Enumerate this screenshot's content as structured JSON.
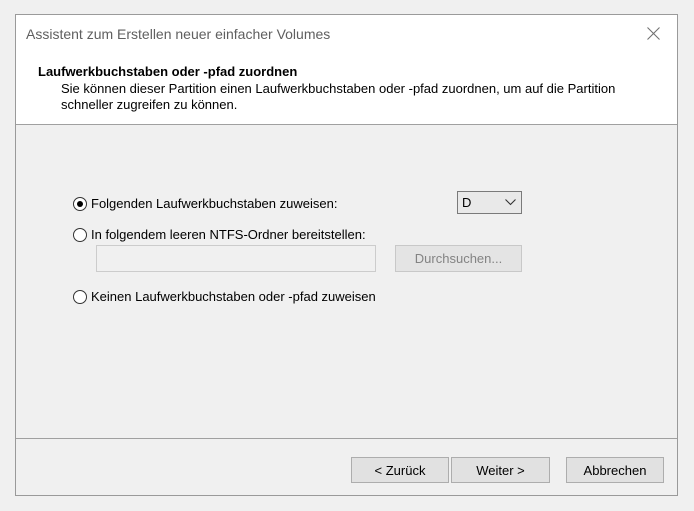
{
  "window": {
    "title": "Assistent zum Erstellen neuer einfacher Volumes"
  },
  "header": {
    "title": "Laufwerkbuchstaben oder -pfad zuordnen",
    "description": "Sie können dieser Partition einen Laufwerkbuchstaben oder -pfad zuordnen, um auf die Partition schneller zugreifen zu können."
  },
  "options": {
    "assign_letter": {
      "label": "Folgenden Laufwerkbuchstaben zuweisen:",
      "checked": true
    },
    "mount_folder": {
      "label": "In folgendem leeren NTFS-Ordner bereitstellen:",
      "checked": false
    },
    "no_letter": {
      "label": "Keinen Laufwerkbuchstaben oder -pfad zuweisen",
      "checked": false
    }
  },
  "drive_select": {
    "value": "D"
  },
  "folder_input": {
    "value": "",
    "placeholder": ""
  },
  "browse_button": {
    "label": "Durchsuchen..."
  },
  "footer": {
    "back_label": "< Zurück",
    "next_label": "Weiter >",
    "cancel_label": "Abbrechen"
  }
}
